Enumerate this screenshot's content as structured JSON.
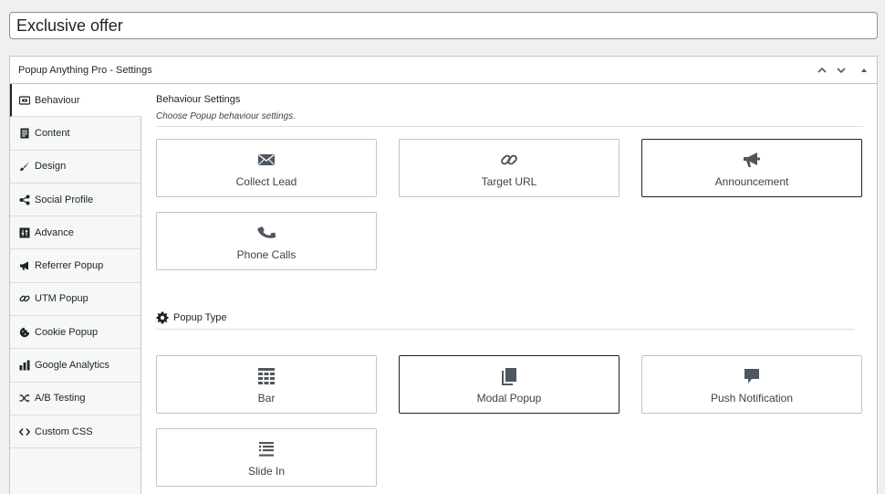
{
  "post_title": {
    "value": "Exclusive offer"
  },
  "metabox": {
    "title": "Popup Anything Pro - Settings",
    "controls": [
      "move-up",
      "move-down",
      "toggle-panel"
    ]
  },
  "tabs": [
    {
      "label": "Behaviour",
      "icon": "eye-icon",
      "active": true
    },
    {
      "label": "Content",
      "icon": "document-icon",
      "active": false
    },
    {
      "label": "Design",
      "icon": "brush-icon",
      "active": false
    },
    {
      "label": "Social Profile",
      "icon": "share-icon",
      "active": false
    },
    {
      "label": "Advance",
      "icon": "sliders-icon",
      "active": false
    },
    {
      "label": "Referrer Popup",
      "icon": "megaphone-icon",
      "active": false
    },
    {
      "label": "UTM Popup",
      "icon": "link-icon",
      "active": false
    },
    {
      "label": "Cookie Popup",
      "icon": "cookie-icon",
      "active": false
    },
    {
      "label": "Google Analytics",
      "icon": "bar-chart-icon",
      "active": false
    },
    {
      "label": "A/B Testing",
      "icon": "shuffle-icon",
      "active": false
    },
    {
      "label": "Custom CSS",
      "icon": "code-icon",
      "active": false
    }
  ],
  "behaviour": {
    "title": "Behaviour Settings",
    "description": "Choose Popup behaviour settings.",
    "options": [
      {
        "label": "Collect Lead",
        "icon": "envelope-icon",
        "selected": false
      },
      {
        "label": "Target URL",
        "icon": "link-icon",
        "selected": false
      },
      {
        "label": "Announcement",
        "icon": "megaphone-icon",
        "selected": true
      },
      {
        "label": "Phone Calls",
        "icon": "phone-icon",
        "selected": false
      }
    ]
  },
  "popup_type": {
    "title": "Popup Type",
    "icon": "gear-icon",
    "options": [
      {
        "label": "Bar",
        "icon": "table-icon",
        "selected": false
      },
      {
        "label": "Modal Popup",
        "icon": "copy-icon",
        "selected": true
      },
      {
        "label": "Push Notification",
        "icon": "speech-bubble-icon",
        "selected": false
      },
      {
        "label": "Slide In",
        "icon": "list-icon",
        "selected": false
      }
    ]
  }
}
